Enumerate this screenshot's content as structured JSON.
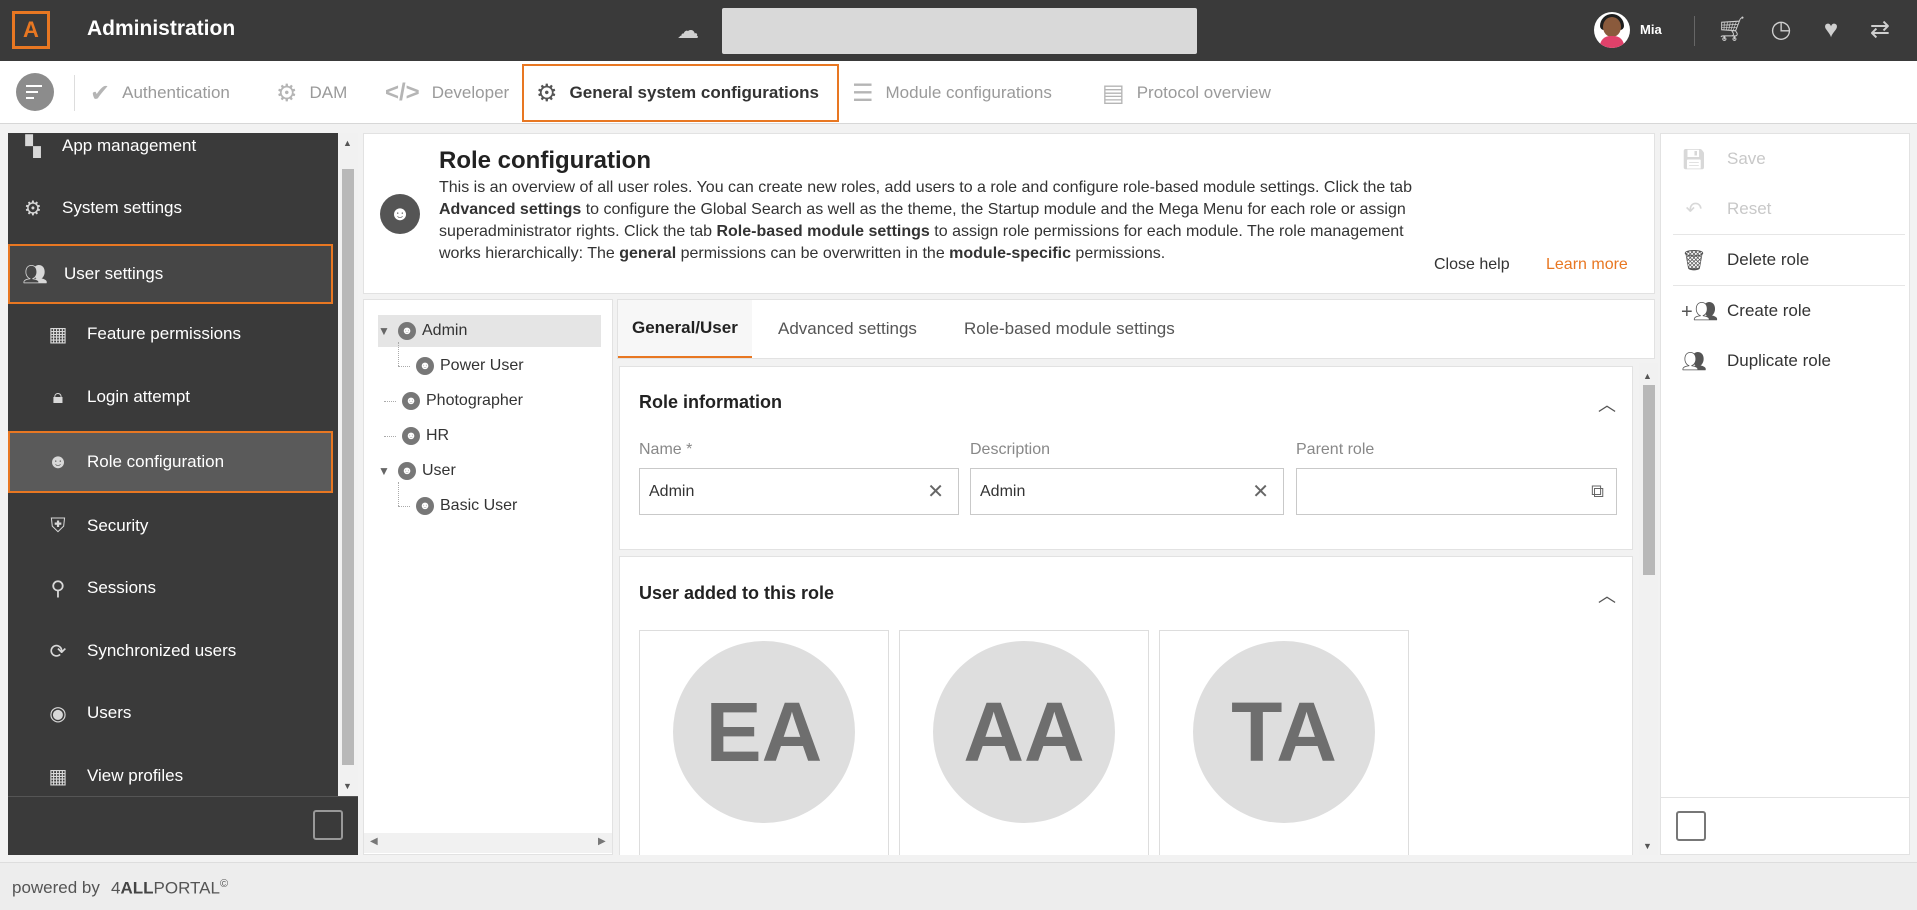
{
  "header": {
    "logo_text": "A",
    "title": "Administration",
    "search_placeholder": "",
    "username": "Mia",
    "icons": [
      "upload-icon",
      "cart-icon",
      "clock-icon",
      "heart-icon",
      "switch-icon"
    ]
  },
  "nav": {
    "items": [
      {
        "label": "Authentication",
        "icon": "shield-check-icon"
      },
      {
        "label": "DAM",
        "icon": "dam-gear-icon"
      },
      {
        "label": "Developer",
        "icon": "code-icon"
      },
      {
        "label": "General system configurations",
        "icon": "gear-icon"
      },
      {
        "label": "Module configurations",
        "icon": "sliders-icon"
      },
      {
        "label": "Protocol overview",
        "icon": "document-icon"
      }
    ],
    "active_index": 3
  },
  "sidebar": {
    "items": [
      {
        "label": "App management",
        "icon": "apps-icon"
      },
      {
        "label": "System settings",
        "icon": "gear-box-icon"
      },
      {
        "label": "User settings",
        "icon": "users-icon"
      },
      {
        "label": "Feature permissions",
        "icon": "feature-permission-icon"
      },
      {
        "label": "Login attempt",
        "icon": "lock-icon"
      },
      {
        "label": "Role configuration",
        "icon": "role-icon"
      },
      {
        "label": "Security",
        "icon": "shield-icon"
      },
      {
        "label": "Sessions",
        "icon": "session-icon"
      },
      {
        "label": "Synchronized users",
        "icon": "sync-user-icon"
      },
      {
        "label": "Users",
        "icon": "user-circle-icon"
      },
      {
        "label": "View profiles",
        "icon": "grid-icon"
      }
    ],
    "selected": "Role configuration"
  },
  "help": {
    "title": "Role configuration",
    "text_1": "This is an overview of all user roles. You can create new roles, add users to a role and configure role-based module settings. Click the tab ",
    "bold_1": "Advanced settings",
    "text_2": " to configure the Global Search as well as the theme, the Startup module and the Mega Menu for each role or assign superadministrator rights. Click the tab ",
    "bold_2": "Role-based module settings",
    "text_3": " to assign role permissions for each module. The role management works hierarchically: The ",
    "bold_3": "general",
    "text_4": " permissions can be overwritten in the ",
    "bold_4": "module-specific",
    "text_5": " permissions.",
    "close_label": "Close help",
    "learn_more_label": "Learn more"
  },
  "tree": {
    "nodes": [
      {
        "label": "Admin",
        "level": 0,
        "expanded": true,
        "selected": true
      },
      {
        "label": "Power User",
        "level": 1
      },
      {
        "label": "Photographer",
        "level": 0
      },
      {
        "label": "HR",
        "level": 0
      },
      {
        "label": "User",
        "level": 0,
        "expanded": true
      },
      {
        "label": "Basic User",
        "level": 1
      }
    ]
  },
  "tabs": [
    {
      "label": "General/User",
      "active": true
    },
    {
      "label": "Advanced settings"
    },
    {
      "label": "Role-based module settings"
    }
  ],
  "role_info": {
    "title": "Role information",
    "name_label": "Name *",
    "name_value": "Admin",
    "description_label": "Description",
    "description_value": "Admin",
    "parent_label": "Parent role",
    "parent_value": ""
  },
  "users_section": {
    "title": "User added to this role",
    "users": [
      {
        "initials": "EA"
      },
      {
        "initials": "AA"
      },
      {
        "initials": "TA"
      }
    ]
  },
  "actions": {
    "save": "Save",
    "reset": "Reset",
    "delete_role": "Delete role",
    "create_role": "Create role",
    "duplicate_role": "Duplicate role"
  },
  "footer": {
    "powered_by": "powered by",
    "brand_prefix": "4",
    "brand_bold": "ALL",
    "brand_suffix": "PORTAL",
    "brand_mark": "©"
  },
  "colors": {
    "accent": "#e87722",
    "topbar": "#3a3a3a",
    "sidebar": "#3a3a3a"
  }
}
